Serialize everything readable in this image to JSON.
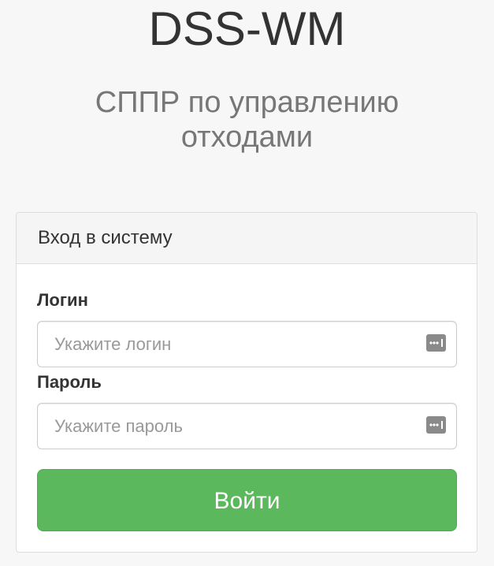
{
  "app": {
    "title": "DSS-WM",
    "subtitle": "СППР по управлению отходами"
  },
  "login_panel": {
    "heading": "Вход в систему",
    "login": {
      "label": "Логин",
      "placeholder": "Укажите логин",
      "value": ""
    },
    "password": {
      "label": "Пароль",
      "placeholder": "Укажите пароль",
      "value": ""
    },
    "submit_label": "Войти"
  },
  "icons": {
    "input_autofill": "password-manager-icon"
  },
  "colors": {
    "background": "#f7f7f7",
    "panel_heading_bg": "#f5f5f5",
    "primary_button": "#5cb85c",
    "title_text": "#333333",
    "subtitle_text": "#777777"
  }
}
